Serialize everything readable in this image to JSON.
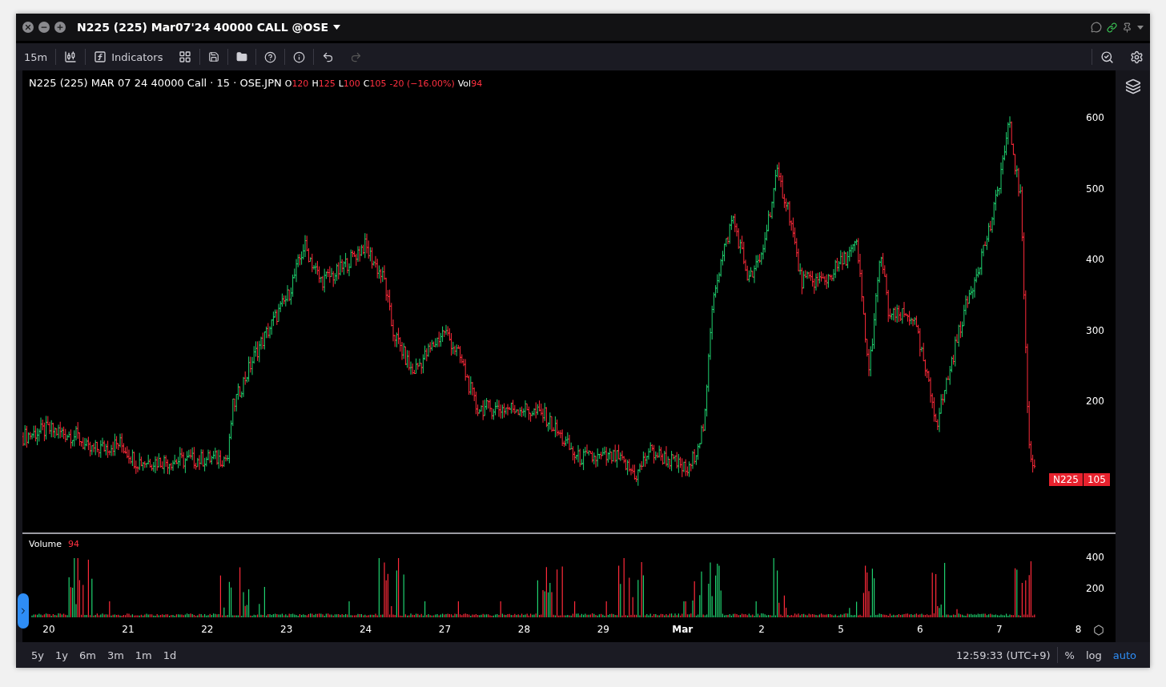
{
  "window": {
    "title": "N225 (225) Mar07'24 40000 CALL @OSE"
  },
  "toolbar": {
    "interval": "15m",
    "indicators_label": "Indicators"
  },
  "legend": {
    "symbol": "N225 (225) MAR 07 24 40000 Call · 15 · OSE.JPN",
    "ohlc": [
      {
        "key": "O",
        "value": "120"
      },
      {
        "key": "H",
        "value": "125"
      },
      {
        "key": "L",
        "value": "100"
      },
      {
        "key": "C",
        "value": "105"
      }
    ],
    "change": "-20 (−16.00%)",
    "volume_key": "Vol",
    "volume_value": "94"
  },
  "price_axis": {
    "ticks": [
      "600",
      "500",
      "400",
      "300",
      "200"
    ]
  },
  "price_tag": {
    "symbol": "N225",
    "value": "105"
  },
  "volume_pane": {
    "title": "Volume",
    "value": "94",
    "ticks": [
      "400",
      "200"
    ]
  },
  "time_axis": {
    "labels": [
      {
        "label": "20",
        "kind": "day"
      },
      {
        "label": "21",
        "kind": "day"
      },
      {
        "label": "22",
        "kind": "day"
      },
      {
        "label": "23",
        "kind": "day"
      },
      {
        "label": "24",
        "kind": "day"
      },
      {
        "label": "27",
        "kind": "day"
      },
      {
        "label": "28",
        "kind": "day"
      },
      {
        "label": "29",
        "kind": "day"
      },
      {
        "label": "Mar",
        "kind": "month"
      },
      {
        "label": "2",
        "kind": "day"
      },
      {
        "label": "5",
        "kind": "day"
      },
      {
        "label": "6",
        "kind": "day"
      },
      {
        "label": "7",
        "kind": "day"
      },
      {
        "label": "8",
        "kind": "day"
      }
    ]
  },
  "bottom_bar": {
    "ranges": [
      "5y",
      "1y",
      "6m",
      "3m",
      "1m",
      "1d"
    ],
    "clock": "12:59:33 (UTC+9)",
    "scale_options": [
      {
        "label": "%",
        "selected": false
      },
      {
        "label": "log",
        "selected": false
      },
      {
        "label": "auto",
        "selected": true
      }
    ]
  }
}
